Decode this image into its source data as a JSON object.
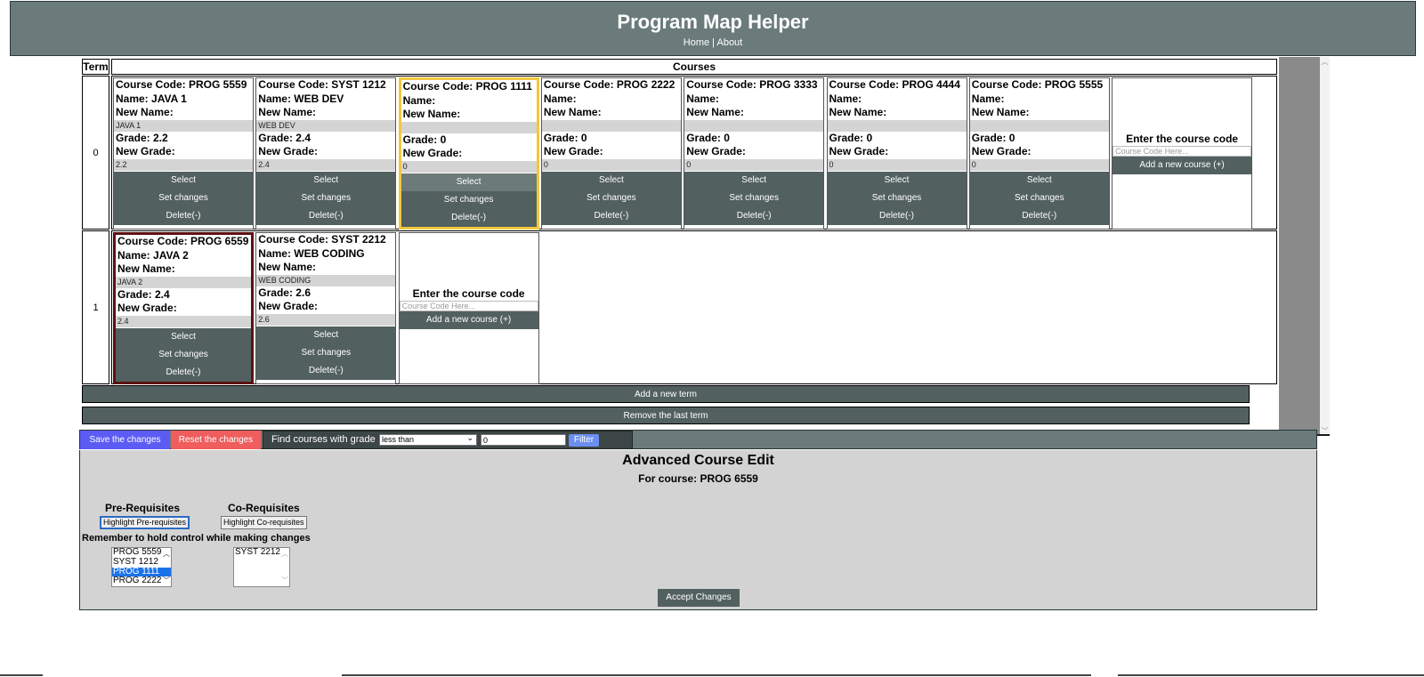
{
  "header": {
    "title": "Program Map Helper",
    "nav_home": "Home",
    "nav_sep": " | ",
    "nav_about": "About"
  },
  "grid": {
    "term_header": "Term",
    "courses_header": "Courses",
    "terms": [
      {
        "label": "0",
        "courses": [
          {
            "code_line": "Course Code: PROG 5559",
            "name_line": "Name: JAVA 1",
            "new_name_label": "New Name:",
            "new_name_value": "JAVA 1",
            "grade_line": "Grade: 2.2",
            "new_grade_label": "New Grade:",
            "new_grade_value": "2.2",
            "select": "Select",
            "set": "Set changes",
            "delete": "Delete(-)"
          },
          {
            "code_line": "Course Code: SYST 1212",
            "name_line": "Name: WEB DEV",
            "new_name_label": "New Name:",
            "new_name_value": "WEB DEV",
            "grade_line": "Grade: 2.4",
            "new_grade_label": "New Grade:",
            "new_grade_value": "2.4",
            "select": "Select",
            "set": "Set changes",
            "delete": "Delete(-)"
          },
          {
            "code_line": "Course Code: PROG 1111",
            "name_line": "Name:",
            "new_name_label": "New Name:",
            "new_name_value": "",
            "grade_line": "Grade: 0",
            "new_grade_label": "New Grade:",
            "new_grade_value": "0",
            "select": "Select",
            "set": "Set changes",
            "delete": "Delete(-)"
          },
          {
            "code_line": "Course Code: PROG 2222",
            "name_line": "Name:",
            "new_name_label": "New Name:",
            "new_name_value": "",
            "grade_line": "Grade: 0",
            "new_grade_label": "New Grade:",
            "new_grade_value": "0",
            "select": "Select",
            "set": "Set changes",
            "delete": "Delete(-)"
          },
          {
            "code_line": "Course Code: PROG 3333",
            "name_line": "Name:",
            "new_name_label": "New Name:",
            "new_name_value": "",
            "grade_line": "Grade: 0",
            "new_grade_label": "New Grade:",
            "new_grade_value": "0",
            "select": "Select",
            "set": "Set changes",
            "delete": "Delete(-)"
          },
          {
            "code_line": "Course Code: PROG 4444",
            "name_line": "Name:",
            "new_name_label": "New Name:",
            "new_name_value": "",
            "grade_line": "Grade: 0",
            "new_grade_label": "New Grade:",
            "new_grade_value": "0",
            "select": "Select",
            "set": "Set changes",
            "delete": "Delete(-)"
          },
          {
            "code_line": "Course Code: PROG 5555",
            "name_line": "Name:",
            "new_name_label": "New Name:",
            "new_name_value": "",
            "grade_line": "Grade: 0",
            "new_grade_label": "New Grade:",
            "new_grade_value": "0",
            "select": "Select",
            "set": "Set changes",
            "delete": "Delete(-)"
          }
        ],
        "add": {
          "label": "Enter the course code",
          "placeholder": "Course Code Here...",
          "button": "Add a new course (+)"
        }
      },
      {
        "label": "1",
        "courses": [
          {
            "code_line": "Course Code: PROG 6559",
            "name_line": "Name: JAVA 2",
            "new_name_label": "New Name:",
            "new_name_value": "JAVA 2",
            "grade_line": "Grade: 2.4",
            "new_grade_label": "New Grade:",
            "new_grade_value": "2.4",
            "select": "Select",
            "set": "Set changes",
            "delete": "Delete(-)"
          },
          {
            "code_line": "Course Code: SYST 2212",
            "name_line": "Name: WEB CODING",
            "new_name_label": "New Name:",
            "new_name_value": "WEB CODING",
            "grade_line": "Grade: 2.6",
            "new_grade_label": "New Grade:",
            "new_grade_value": "2.6",
            "select": "Select",
            "set": "Set changes",
            "delete": "Delete(-)"
          }
        ],
        "add": {
          "label": "Enter the course code",
          "placeholder": "Course Code Here...",
          "button": "Add a new course (+)"
        }
      }
    ],
    "add_term": "Add a new term",
    "remove_term": "Remove the last term"
  },
  "toolbar": {
    "save": "Save the changes",
    "reset": "Reset the changes",
    "filter_label": "Find courses with grade",
    "filter_select": "less than",
    "filter_value": "0",
    "filter_button": "Filter"
  },
  "advanced": {
    "title": "Advanced Course Edit",
    "subtitle": "For course: PROG 6559",
    "prereq_heading": "Pre-Requisites",
    "coreq_heading": "Co-Requisites",
    "highlight_pre": "Highlight Pre-requisites",
    "highlight_co": "Highlight Co-requisites",
    "remember": "Remember to hold control while making changes",
    "prereq_options": [
      "PROG 5559",
      "SYST 1212",
      "PROG 1111",
      "PROG 2222"
    ],
    "prereq_selected": "PROG 1111",
    "coreq_options": [
      "SYST 2212"
    ],
    "accept": "Accept Changes"
  },
  "colors": {
    "header": "#6b7b7b",
    "button": "#536060",
    "save": "#5c5cf5",
    "reset": "#ef5d5d",
    "selected_yellow": "#f2c73f",
    "selected_red": "#5c1010"
  }
}
